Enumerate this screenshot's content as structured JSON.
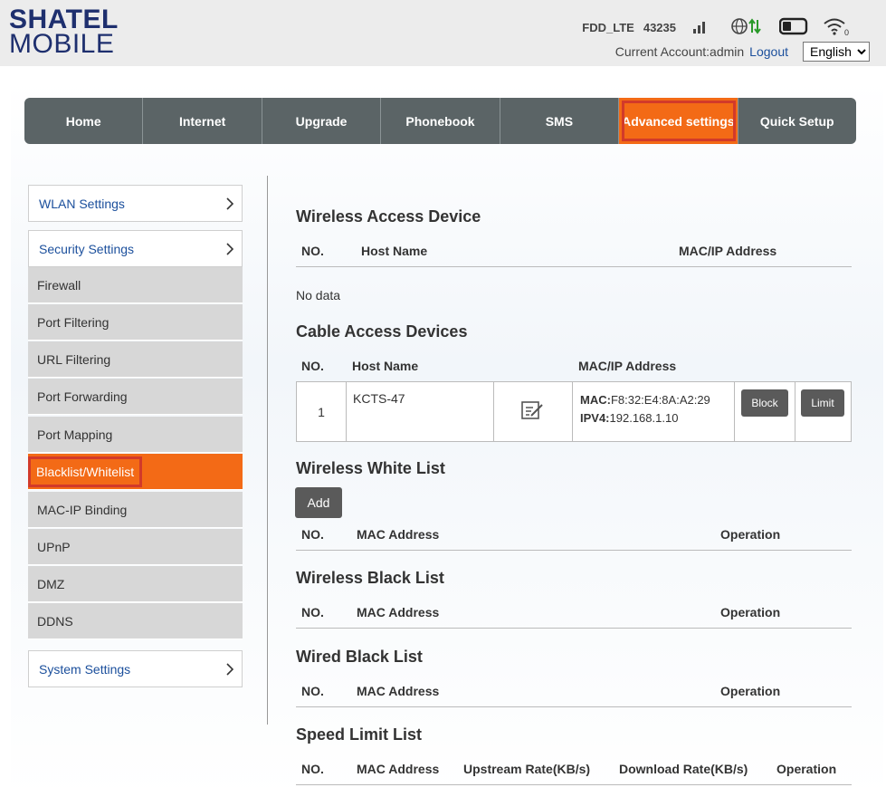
{
  "header": {
    "logo_line1": "SHATEL",
    "logo_line2": "MOBILE",
    "network_type": "FDD_LTE",
    "network_code": "43235",
    "account_text": "Current Account:admin",
    "logout_label": "Logout",
    "language": "English"
  },
  "nav": {
    "items": [
      "Home",
      "Internet",
      "Upgrade",
      "Phonebook",
      "SMS",
      "Advanced settings",
      "Quick Setup"
    ],
    "active_index": 5
  },
  "sidebar": {
    "wlan_settings": "WLAN Settings",
    "security_settings": "Security Settings",
    "sub_items": [
      "Firewall",
      "Port Filtering",
      "URL Filtering",
      "Port Forwarding",
      "Port Mapping",
      "Blacklist/Whitelist",
      "MAC-IP Binding",
      "UPnP",
      "DMZ",
      "DDNS"
    ],
    "active_sub": "Blacklist/Whitelist",
    "system_settings": "System Settings"
  },
  "wireless_access": {
    "title": "Wireless Access Device",
    "col_no": "NO.",
    "col_host": "Host Name",
    "col_mac": "MAC/IP Address",
    "empty": "No data"
  },
  "cable_access": {
    "title": "Cable Access Devices",
    "col_no": "NO.",
    "col_host": "Host Name",
    "col_mac": "MAC/IP Address",
    "rows": [
      {
        "no": "1",
        "host": "KCTS-47",
        "mac_label": "MAC:",
        "mac": "F8:32:E4:8A:A2:29",
        "ipv4_label": "IPV4:",
        "ipv4": "192.168.1.10",
        "block_label": "Block",
        "limit_label": "Limit"
      }
    ]
  },
  "white_list": {
    "title": "Wireless White List",
    "add_label": "Add",
    "col_no": "NO.",
    "col_mac": "MAC Address",
    "col_op": "Operation"
  },
  "black_list": {
    "title": "Wireless Black List",
    "col_no": "NO.",
    "col_mac": "MAC Address",
    "col_op": "Operation"
  },
  "wired_black_list": {
    "title": "Wired Black List",
    "col_no": "NO.",
    "col_mac": "MAC Address",
    "col_op": "Operation"
  },
  "speed_limit": {
    "title": "Speed Limit List",
    "col_no": "NO.",
    "col_mac": "MAC Address",
    "col_up": "Upstream Rate(KB/s)",
    "col_down": "Download Rate(KB/s)",
    "col_op": "Operation"
  },
  "colors": {
    "accent": "#f36a16",
    "highlight_border": "#d23a2a",
    "nav_bg": "#5b6466",
    "logo": "#1e2f6e",
    "link": "#1b4f9c"
  },
  "icons": {
    "signal": "signal-bars-icon",
    "globe": "globe-data-icon",
    "battery": "battery-icon",
    "wifi": "wifi-icon",
    "edit": "edit-icon",
    "chevron": "chevron-right-icon"
  }
}
